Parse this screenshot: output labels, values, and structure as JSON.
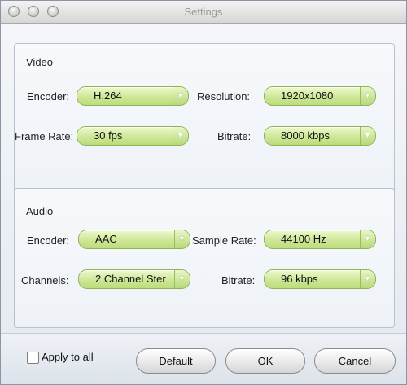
{
  "window": {
    "title": "Settings"
  },
  "video": {
    "heading": "Video",
    "encoder_label": "Encoder:",
    "encoder_value": "H.264",
    "resolution_label": "Resolution:",
    "resolution_value": "1920x1080",
    "framerate_label": "Frame Rate:",
    "framerate_value": "30 fps",
    "bitrate_label": "Bitrate:",
    "bitrate_value": "8000 kbps"
  },
  "audio": {
    "heading": "Audio",
    "encoder_label": "Encoder:",
    "encoder_value": "AAC",
    "samplerate_label": "Sample Rate:",
    "samplerate_value": "44100 Hz",
    "channels_label": "Channels:",
    "channels_value": "2 Channel Ster",
    "bitrate_label": "Bitrate:",
    "bitrate_value": "96 kbps"
  },
  "footer": {
    "apply_all_label": "Apply to all",
    "apply_all_checked": false,
    "default_label": "Default",
    "ok_label": "OK",
    "cancel_label": "Cancel"
  },
  "icons": {
    "window_controls": [
      "close-icon",
      "minimize-icon",
      "zoom-icon"
    ],
    "combo_arrow": "chevron-down-icon"
  },
  "colors": {
    "combo_fill": "#cfe799",
    "window_bg": "#e9edf3"
  }
}
